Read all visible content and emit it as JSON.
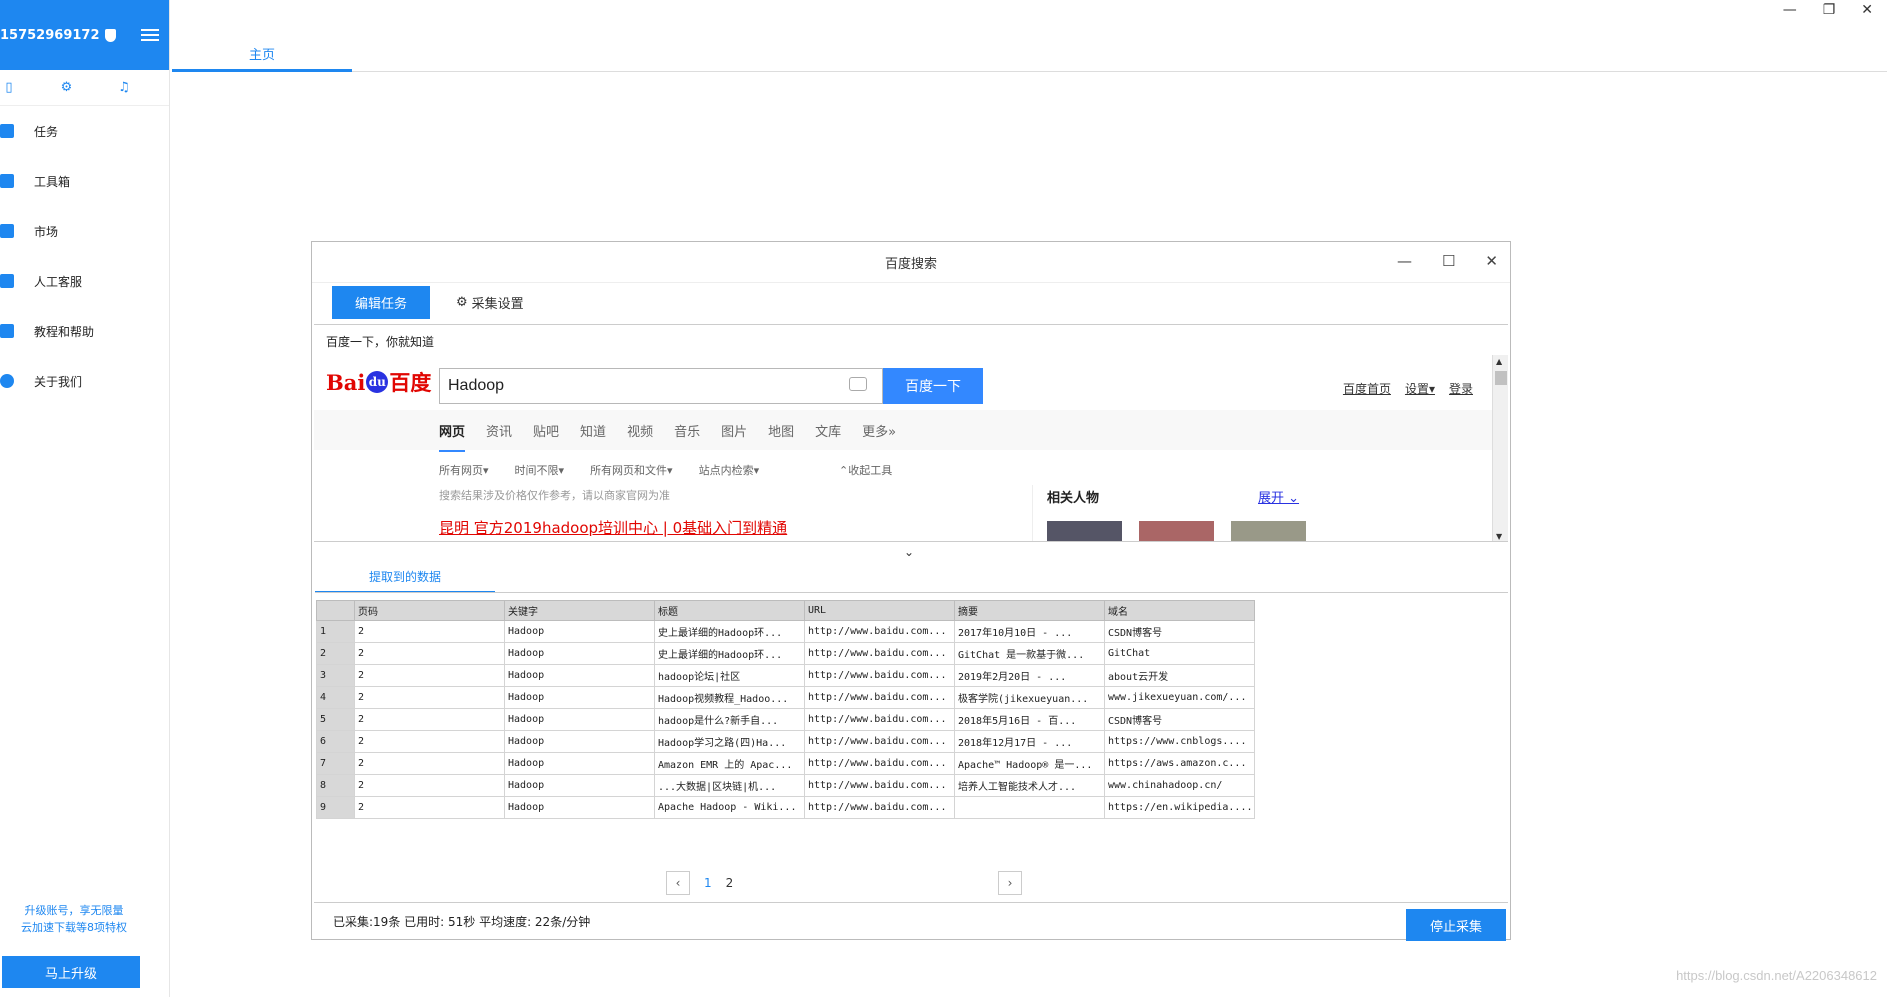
{
  "sidebar": {
    "account": "15752969172",
    "items": [
      {
        "label": "任务"
      },
      {
        "label": "工具箱"
      },
      {
        "label": "市场"
      },
      {
        "label": "人工客服"
      },
      {
        "label": "教程和帮助"
      },
      {
        "label": "关于我们"
      }
    ],
    "promo_line1": "升级账号，享无限量",
    "promo_line2": "云加速下载等8项特权",
    "upgrade_label": "马上升级"
  },
  "topbar": {
    "tab_home": "主页"
  },
  "dialog": {
    "title": "百度搜索",
    "tab_edit": "编辑任务",
    "tab_settings": "采集设置"
  },
  "browser": {
    "tagline": "百度一下，你就知道",
    "logo_text_left": "Bai",
    "logo_text_du": "du",
    "logo_text_right": "百度",
    "search_value": "Hadoop",
    "search_button": "百度一下",
    "links": [
      "百度首页",
      "设置▾",
      "登录"
    ],
    "nav": [
      "网页",
      "资讯",
      "贴吧",
      "知道",
      "视频",
      "音乐",
      "图片",
      "地图",
      "文库",
      "更多»"
    ],
    "filters": [
      "所有网页▾",
      "时间不限▾",
      "所有网页和文件▾",
      "站点内检索▾"
    ],
    "collapse_tools": "⌃收起工具",
    "notice": "搜索结果涉及价格仅作参考，请以商家官网为准",
    "result_title": "昆明 官方2019hadoop培训中心 | 0基础入门到精通",
    "related": "相关人物",
    "expand": "展开 ⌄"
  },
  "data": {
    "tab_label": "提取到的数据",
    "columns": [
      "页码",
      "关键字",
      "标题",
      "URL",
      "摘要",
      "域名"
    ],
    "rows": [
      [
        "1",
        "2",
        "Hadoop",
        "史上最详细的Hadoop环...",
        "http://www.baidu.com...",
        "2017年10月10日 - ...",
        "CSDN博客号"
      ],
      [
        "2",
        "2",
        "Hadoop",
        "史上最详细的Hadoop环...",
        "http://www.baidu.com...",
        "GitChat 是一款基于微...",
        "GitChat"
      ],
      [
        "3",
        "2",
        "Hadoop",
        "hadoop论坛|社区",
        "http://www.baidu.com...",
        "2019年2月20日 - ...",
        "about云开发"
      ],
      [
        "4",
        "2",
        "Hadoop",
        "Hadoop视频教程_Hadoo...",
        "http://www.baidu.com...",
        "极客学院(jikexueyuan...",
        "www.jikexueyuan.com/..."
      ],
      [
        "5",
        "2",
        "Hadoop",
        "hadoop是什么?新手自...",
        "http://www.baidu.com...",
        "2018年5月16日 - 百...",
        "CSDN博客号"
      ],
      [
        "6",
        "2",
        "Hadoop",
        "Hadoop学习之路(四)Ha...",
        "http://www.baidu.com...",
        "2018年12月17日 - ...",
        "https://www.cnblogs...."
      ],
      [
        "7",
        "2",
        "Hadoop",
        "Amazon EMR 上的 Apac...",
        "http://www.baidu.com...",
        "Apache™ Hadoop® 是一...",
        "https://aws.amazon.c..."
      ],
      [
        "8",
        "2",
        "Hadoop",
        "...大数据|区块链|机...",
        "http://www.baidu.com...",
        "培养人工智能技术人才...",
        "www.chinahadoop.cn/"
      ],
      [
        "9",
        "2",
        "Hadoop",
        "Apache Hadoop - Wiki...",
        "http://www.baidu.com...",
        "",
        "https://en.wikipedia...."
      ]
    ],
    "pages": [
      "1",
      "2"
    ]
  },
  "status": {
    "text": "已采集:19条  已用时: 51秒  平均速度: 22条/分钟",
    "stop_label": "停止采集"
  },
  "watermark": "https://blog.csdn.net/A2206348612"
}
